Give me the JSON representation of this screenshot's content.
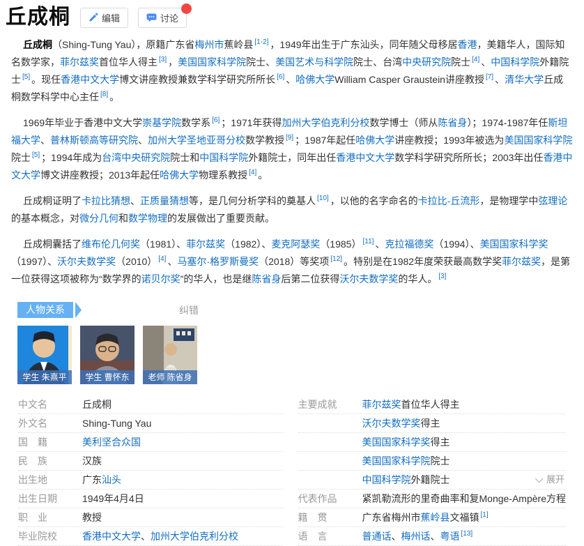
{
  "header": {
    "title": "丘成桐",
    "edit_label": "编辑",
    "discuss_label": "讨论"
  },
  "colors": {
    "link": "#136ec2",
    "ribbon_blue": "#66b1f4",
    "badge_red": "#f34642",
    "label_gray": "#999999"
  },
  "paragraphs": [
    [
      {
        "t": "丘成桐",
        "s": "b"
      },
      {
        "t": "（Shing-Tung Yau），原籍广东省",
        "s": ""
      },
      {
        "t": "梅州市",
        "s": "l"
      },
      {
        "t": "蕉岭县",
        "s": ""
      },
      {
        "t": "[1-2]",
        "s": "sup"
      },
      {
        "t": "，1949年出生于广东汕头，同年随父母移居",
        "s": ""
      },
      {
        "t": "香港",
        "s": "l"
      },
      {
        "t": "，美籍华人，国际知名数学家，",
        "s": ""
      },
      {
        "t": "菲尔兹奖",
        "s": "l"
      },
      {
        "t": "首位华人得主",
        "s": ""
      },
      {
        "t": "[3]",
        "s": "sup"
      },
      {
        "t": "，",
        "s": ""
      },
      {
        "t": "美国国家科学院",
        "s": "l"
      },
      {
        "t": "院士、",
        "s": ""
      },
      {
        "t": "美国艺术与科学院",
        "s": "l"
      },
      {
        "t": "院士、台湾",
        "s": ""
      },
      {
        "t": "中央研究院",
        "s": "l"
      },
      {
        "t": "院士",
        "s": ""
      },
      {
        "t": "[4]",
        "s": "sup"
      },
      {
        "t": "、",
        "s": ""
      },
      {
        "t": "中国科学院",
        "s": "l"
      },
      {
        "t": "外籍院士",
        "s": ""
      },
      {
        "t": "[5]",
        "s": "sup"
      },
      {
        "t": "。现任",
        "s": ""
      },
      {
        "t": "香港中文大学",
        "s": "l"
      },
      {
        "t": "博文讲座教授兼数学科学研究所所长",
        "s": ""
      },
      {
        "t": "[6]",
        "s": "sup"
      },
      {
        "t": "、",
        "s": ""
      },
      {
        "t": "哈佛大学",
        "s": "l"
      },
      {
        "t": "William Casper Graustein讲座教授",
        "s": ""
      },
      {
        "t": "[7]",
        "s": "sup"
      },
      {
        "t": "、",
        "s": ""
      },
      {
        "t": "清华大学",
        "s": "l"
      },
      {
        "t": "丘成桐数学科学中心主任",
        "s": ""
      },
      {
        "t": "[8]",
        "s": "sup"
      },
      {
        "t": "。",
        "s": ""
      }
    ],
    [
      {
        "t": "1969年毕业于香港中文大学",
        "s": ""
      },
      {
        "t": "崇基学院",
        "s": "l"
      },
      {
        "t": "数学系",
        "s": ""
      },
      {
        "t": "[6]",
        "s": "sup"
      },
      {
        "t": "；1971年获得",
        "s": ""
      },
      {
        "t": "加州大学伯克利分校",
        "s": "l"
      },
      {
        "t": "数学博士（师从",
        "s": ""
      },
      {
        "t": "陈省身",
        "s": "l"
      },
      {
        "t": "）；1974-1987年任",
        "s": ""
      },
      {
        "t": "斯坦福大学",
        "s": "l"
      },
      {
        "t": "、",
        "s": ""
      },
      {
        "t": "普林斯顿高等研究院",
        "s": "l"
      },
      {
        "t": "、",
        "s": ""
      },
      {
        "t": "加州大学圣地亚哥分校",
        "s": "l"
      },
      {
        "t": "数学教授",
        "s": ""
      },
      {
        "t": "[9]",
        "s": "sup"
      },
      {
        "t": "；1987年起任",
        "s": ""
      },
      {
        "t": "哈佛大学",
        "s": "l"
      },
      {
        "t": "讲座教授；1993年被选为",
        "s": ""
      },
      {
        "t": "美国国家科学院",
        "s": "l"
      },
      {
        "t": "院士",
        "s": ""
      },
      {
        "t": "[5]",
        "s": "sup"
      },
      {
        "t": "；1994年成为",
        "s": ""
      },
      {
        "t": "台湾中央研究院",
        "s": "l"
      },
      {
        "t": "院士和",
        "s": ""
      },
      {
        "t": "中国科学院",
        "s": "l"
      },
      {
        "t": "外籍院士，同年出任",
        "s": ""
      },
      {
        "t": "香港中文大学",
        "s": "l"
      },
      {
        "t": "数学科学研究所所长；2003年出任",
        "s": ""
      },
      {
        "t": "香港中文大学",
        "s": "l"
      },
      {
        "t": "博文讲座教授；2013年起任",
        "s": ""
      },
      {
        "t": "哈佛大学",
        "s": "l"
      },
      {
        "t": "物理系教授",
        "s": ""
      },
      {
        "t": "[4]",
        "s": "sup"
      },
      {
        "t": "。",
        "s": ""
      }
    ],
    [
      {
        "t": "丘成桐证明了",
        "s": ""
      },
      {
        "t": "卡拉比猜想",
        "s": "l"
      },
      {
        "t": "、",
        "s": ""
      },
      {
        "t": "正质量猜想",
        "s": "l"
      },
      {
        "t": "等，是几何分析学科的奠基人",
        "s": ""
      },
      {
        "t": "[10]",
        "s": "sup"
      },
      {
        "t": "，以他的名字命名的",
        "s": ""
      },
      {
        "t": "卡拉比-丘流形",
        "s": "l"
      },
      {
        "t": "，是物理学中",
        "s": ""
      },
      {
        "t": "弦理论",
        "s": "l"
      },
      {
        "t": "的基本概念，对",
        "s": ""
      },
      {
        "t": "微分几何",
        "s": "l"
      },
      {
        "t": "和",
        "s": ""
      },
      {
        "t": "数学物理",
        "s": "l"
      },
      {
        "t": "的发展做出了重要贡献。",
        "s": ""
      }
    ],
    [
      {
        "t": "丘成桐囊括了",
        "s": ""
      },
      {
        "t": "维布伦几何奖",
        "s": "l"
      },
      {
        "t": "（1981）、",
        "s": ""
      },
      {
        "t": "菲尔兹奖",
        "s": "l"
      },
      {
        "t": "（1982）、",
        "s": ""
      },
      {
        "t": "麦克阿瑟奖",
        "s": "l"
      },
      {
        "t": "（1985）",
        "s": ""
      },
      {
        "t": "[11]",
        "s": "sup"
      },
      {
        "t": "、",
        "s": ""
      },
      {
        "t": "克拉福德奖",
        "s": "l"
      },
      {
        "t": "（1994）、",
        "s": ""
      },
      {
        "t": "美国国家科学奖",
        "s": "l"
      },
      {
        "t": "（1997）、",
        "s": ""
      },
      {
        "t": "沃尔夫数学奖",
        "s": "l"
      },
      {
        "t": "（2010）",
        "s": ""
      },
      {
        "t": "[4]",
        "s": "sup"
      },
      {
        "t": "、",
        "s": ""
      },
      {
        "t": "马塞尔·格罗斯曼奖",
        "s": "l"
      },
      {
        "t": "（2018）等奖项",
        "s": ""
      },
      {
        "t": "[12]",
        "s": "sup"
      },
      {
        "t": "。特别是在1982年度荣获最高数学奖",
        "s": ""
      },
      {
        "t": "菲尔兹奖",
        "s": "l"
      },
      {
        "t": "，是第一位获得这项被称为“数学界的",
        "s": ""
      },
      {
        "t": "诺贝尔奖",
        "s": "l"
      },
      {
        "t": "”的华人，也是继",
        "s": ""
      },
      {
        "t": "陈省身",
        "s": "l"
      },
      {
        "t": "后第二位获得",
        "s": ""
      },
      {
        "t": "沃尔夫数学奖",
        "s": "l"
      },
      {
        "t": "的华人。",
        "s": ""
      },
      {
        "t": "[3]",
        "s": "sup"
      }
    ]
  ],
  "relations": {
    "badge": "人物关系",
    "correction": "纠错",
    "cards": [
      {
        "label": "学生 朱熹平"
      },
      {
        "label": "学生 曹怀东"
      },
      {
        "label": "老师 陈省身"
      }
    ]
  },
  "info": {
    "expand_label": "展开",
    "left": [
      {
        "label": "中文名",
        "value": [
          {
            "t": "丘成桐",
            "s": ""
          }
        ]
      },
      {
        "label": "外文名",
        "value": [
          {
            "t": "Shing-Tung Yau",
            "s": ""
          }
        ]
      },
      {
        "label": "国　籍",
        "value": [
          {
            "t": "美利坚合众国",
            "s": "l"
          }
        ]
      },
      {
        "label": "民　族",
        "value": [
          {
            "t": "汉族",
            "s": ""
          }
        ]
      },
      {
        "label": "出生地",
        "value": [
          {
            "t": "广东",
            "s": ""
          },
          {
            "t": "汕头",
            "s": "l"
          }
        ]
      },
      {
        "label": "出生日期",
        "value": [
          {
            "t": "1949年4月4日",
            "s": ""
          }
        ]
      },
      {
        "label": "职　业",
        "value": [
          {
            "t": "教授",
            "s": ""
          }
        ]
      },
      {
        "label": "毕业院校",
        "value": [
          {
            "t": "香港中文大学",
            "s": "l"
          },
          {
            "t": "、",
            "s": ""
          },
          {
            "t": "加州大学伯克利分校",
            "s": "l"
          }
        ]
      }
    ],
    "right": [
      {
        "label": "主要成就",
        "value": [
          {
            "t": "菲尔兹奖",
            "s": "l"
          },
          {
            "t": "首位华人得主",
            "s": ""
          }
        ]
      },
      {
        "label": "",
        "value": [
          {
            "t": "沃尔夫数学奖",
            "s": "l"
          },
          {
            "t": "得主",
            "s": ""
          }
        ]
      },
      {
        "label": "",
        "value": [
          {
            "t": "美国国家科学奖",
            "s": "l"
          },
          {
            "t": "得主",
            "s": ""
          }
        ]
      },
      {
        "label": "",
        "value": [
          {
            "t": "美国国家科学院",
            "s": "l"
          },
          {
            "t": "院士",
            "s": ""
          }
        ]
      },
      {
        "label": "",
        "value": [
          {
            "t": "中国科学院",
            "s": "l"
          },
          {
            "t": "外籍院士",
            "s": ""
          }
        ]
      },
      {
        "label": "代表作品",
        "value": [
          {
            "t": "紧凯勒流形的里奇曲率和复Monge-Ampère方程",
            "s": ""
          }
        ]
      },
      {
        "label": "籍　贯",
        "value": [
          {
            "t": "广东省梅州市",
            "s": ""
          },
          {
            "t": "蕉岭县",
            "s": "l"
          },
          {
            "t": "文福镇",
            "s": ""
          },
          {
            "t": "[1]",
            "s": "sup"
          }
        ]
      },
      {
        "label": "语　言",
        "value": [
          {
            "t": "普通话",
            "s": "l"
          },
          {
            "t": "、",
            "s": ""
          },
          {
            "t": "梅州话",
            "s": "l"
          },
          {
            "t": "、",
            "s": ""
          },
          {
            "t": "粤语",
            "s": "l"
          },
          {
            "t": "[13]",
            "s": "sup"
          }
        ]
      }
    ]
  }
}
